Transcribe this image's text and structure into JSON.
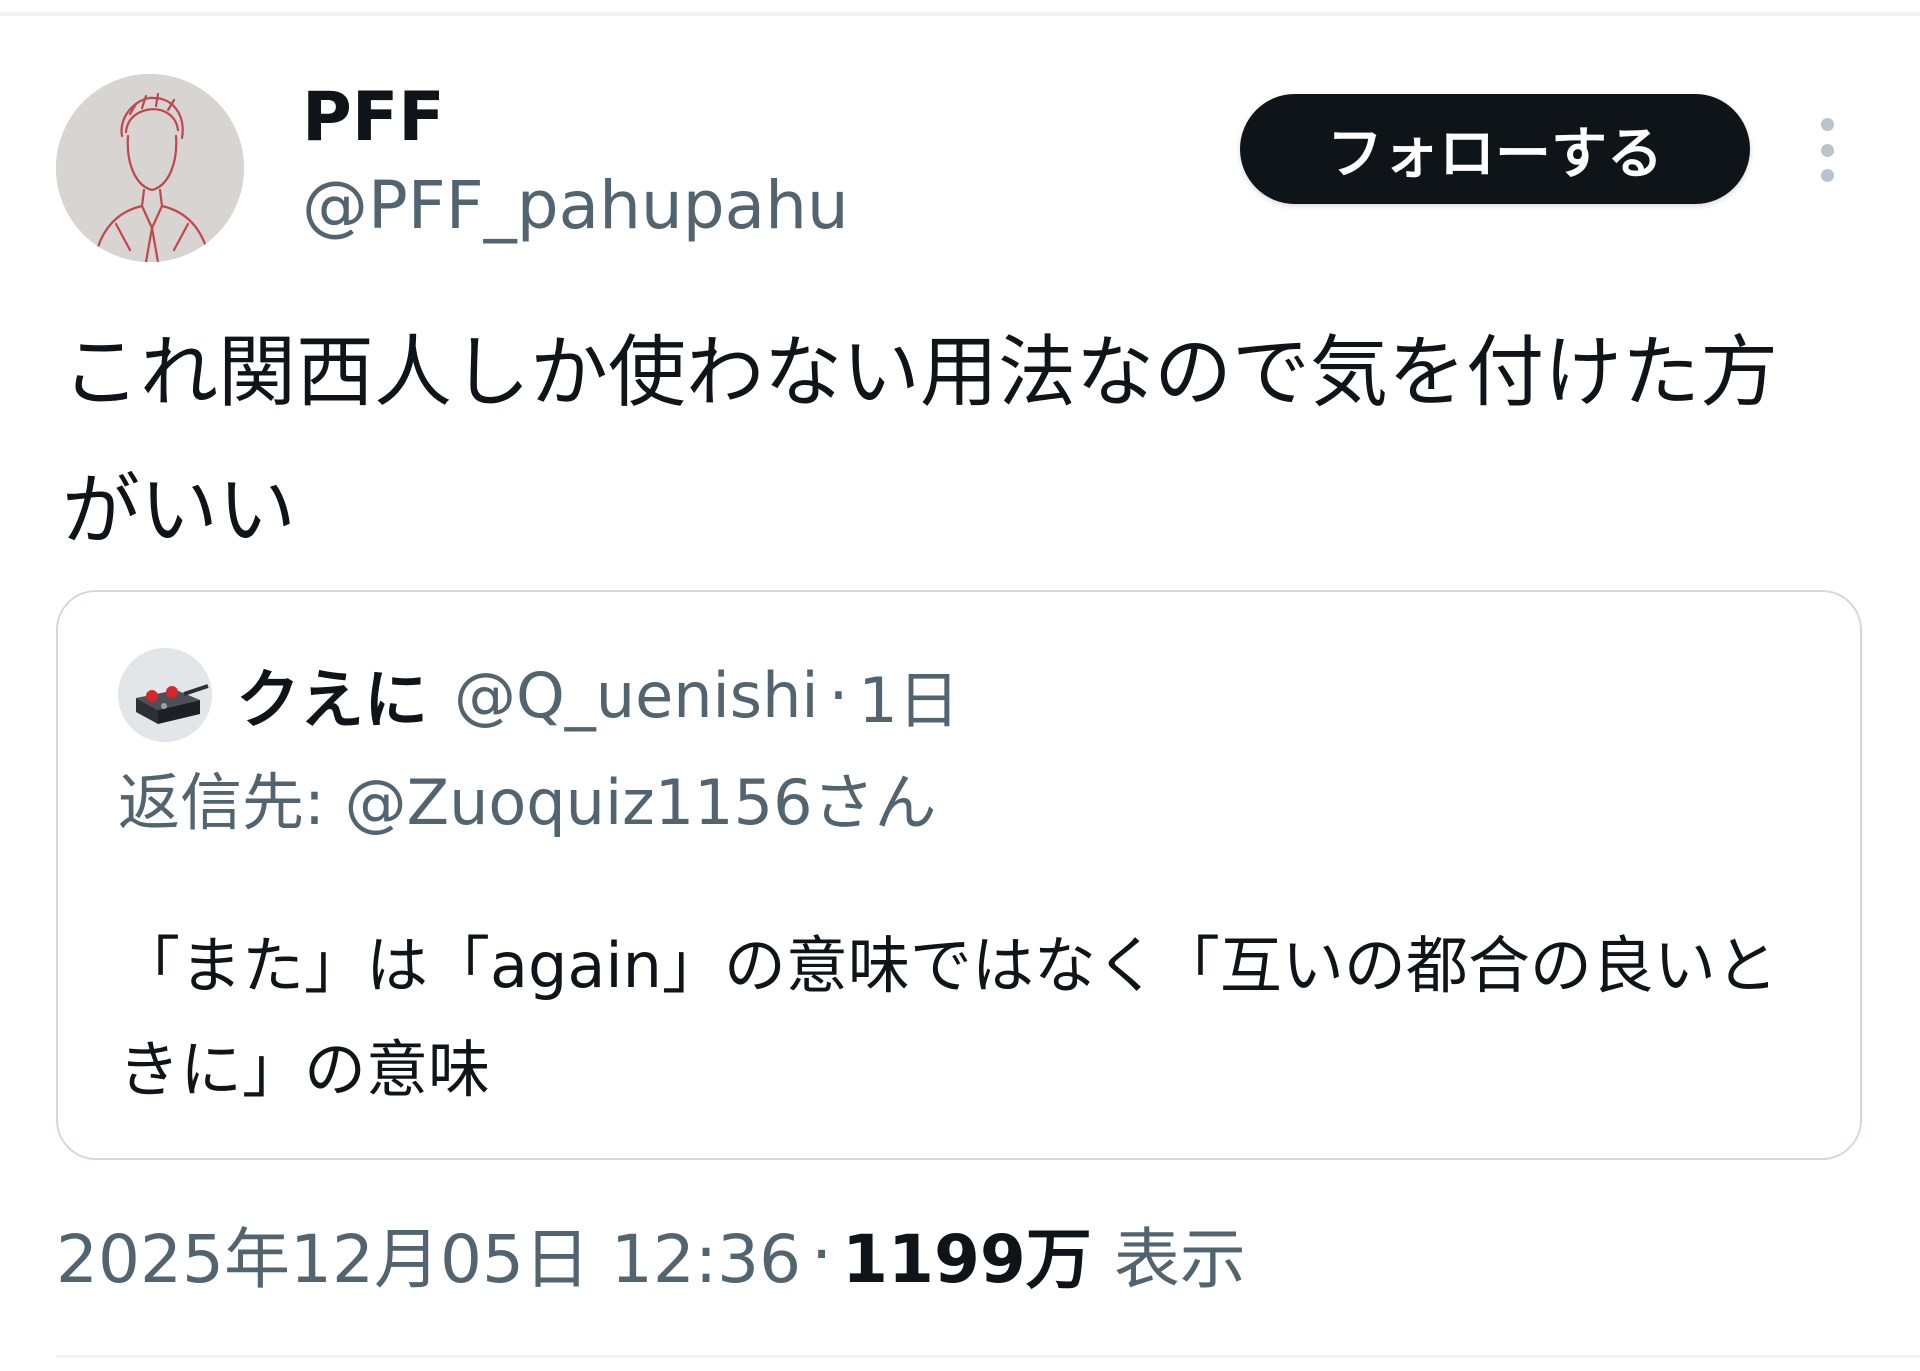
{
  "author": {
    "display_name": "PFF",
    "handle": "@PFF_pahupahu",
    "avatar_icon": "sketch-portrait-avatar"
  },
  "actions": {
    "follow_label": "フォローする",
    "more_icon": "more-vertical-icon"
  },
  "tweet": {
    "text": "これ関西人しか使わない用法なので気を付けた方がいい"
  },
  "quoted_tweet": {
    "display_name": "クえに",
    "handle": "@Q_uenishi",
    "separator": "·",
    "time": "1日",
    "avatar_icon": "device-avatar",
    "reply_prefix": "返信先: ",
    "reply_mention": "@Zuoquiz1156",
    "reply_suffix": "さん",
    "text": "「また」は「again」の意味ではなく「互いの都合の良いときに」の意味"
  },
  "meta": {
    "timestamp": "2025年12月05日 12:36",
    "separator": "·",
    "views_count": "1199万",
    "views_label": "表示"
  },
  "colors": {
    "text_primary": "#0f1419",
    "text_secondary": "#536471",
    "border": "#cfd9de",
    "button_bg": "#0f1419"
  }
}
